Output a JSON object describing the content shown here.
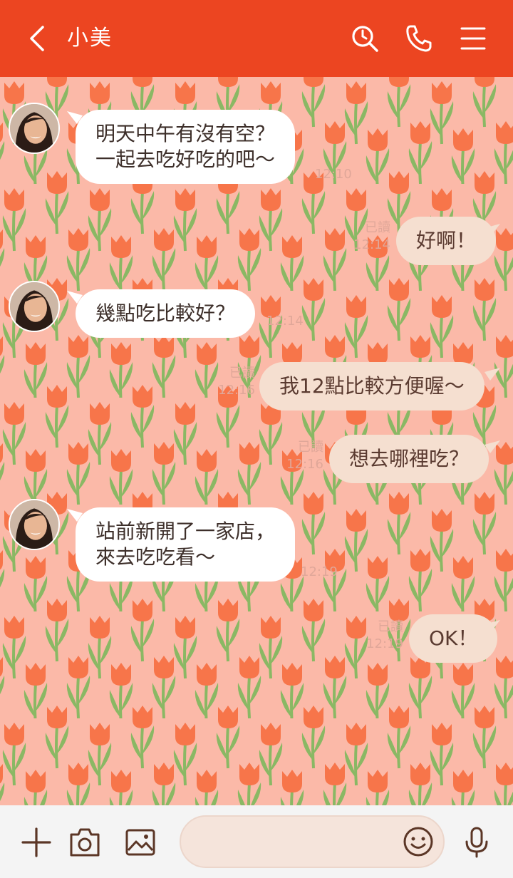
{
  "header": {
    "title": "小美",
    "bg_color": "#ec4521",
    "icons": [
      "back-icon",
      "search-icon",
      "phone-icon",
      "menu-icon"
    ]
  },
  "messages": [
    {
      "dir": "in",
      "text": "明天中午有沒有空？\n一起去吃好吃的吧～",
      "time": "12:10"
    },
    {
      "dir": "out",
      "text": "好啊！",
      "read": "已讀",
      "time": "12:14"
    },
    {
      "dir": "in",
      "text": "幾點吃比較好？",
      "time": "12:14"
    },
    {
      "dir": "out",
      "text": "我12點比較方便喔～",
      "read": "已讀",
      "time": "12:16"
    },
    {
      "dir": "out",
      "text": "想去哪裡吃？",
      "read": "已讀",
      "time": "12:16"
    },
    {
      "dir": "in",
      "text": "站前新開了一家店，\n來去吃吃看～",
      "time": "12:19"
    },
    {
      "dir": "out",
      "text": "OK！",
      "read": "已讀",
      "time": "12:19"
    }
  ],
  "footer": {
    "input_value": "",
    "icons": [
      "plus-icon",
      "camera-icon",
      "image-icon",
      "emoji-icon",
      "microphone-icon"
    ]
  },
  "colors": {
    "background": "#fbb9a8",
    "tulip": "#f7754a",
    "leaf": "#8ab864",
    "incoming_bubble": "#ffffff",
    "outgoing_bubble": "#f5dfd0",
    "meta_text": "#e0a799"
  }
}
